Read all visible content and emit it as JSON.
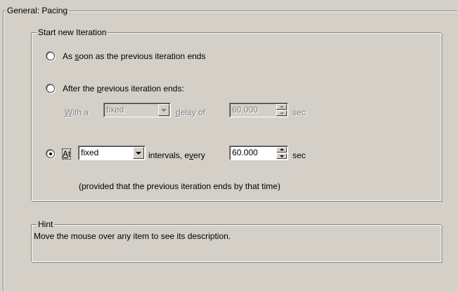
{
  "general_group": {
    "title": "General: Pacing"
  },
  "start_group": {
    "title": "Start new Iteration",
    "option1": {
      "pre": "As ",
      "mnemonic": "s",
      "post": "oon as the previous iteration ends",
      "checked": false
    },
    "option2": {
      "pre": "After the ",
      "mnemonic": "p",
      "post": "revious iteration ends:",
      "checked": false,
      "with_a_mn": "W",
      "with_a_rest": "ith a",
      "combo_value": "fixed",
      "delay_mn": "d",
      "delay_rest": "elay of",
      "spin_value": "60.000",
      "unit": "sec"
    },
    "option3": {
      "mn": "A",
      "rest": "t",
      "checked": true,
      "combo_value": "fixed",
      "intervals_pre": "intervals, e",
      "intervals_mn": "v",
      "intervals_post": "ery",
      "spin_value": "60.000",
      "unit": "sec",
      "note": "(provided that the previous iteration ends by that time)"
    }
  },
  "hint_group": {
    "title": "Hint",
    "text": "Move the mouse over any item to see its description."
  },
  "colors": {
    "dialog_bg": "#d4d0c8",
    "disabled_text": "#808080"
  }
}
